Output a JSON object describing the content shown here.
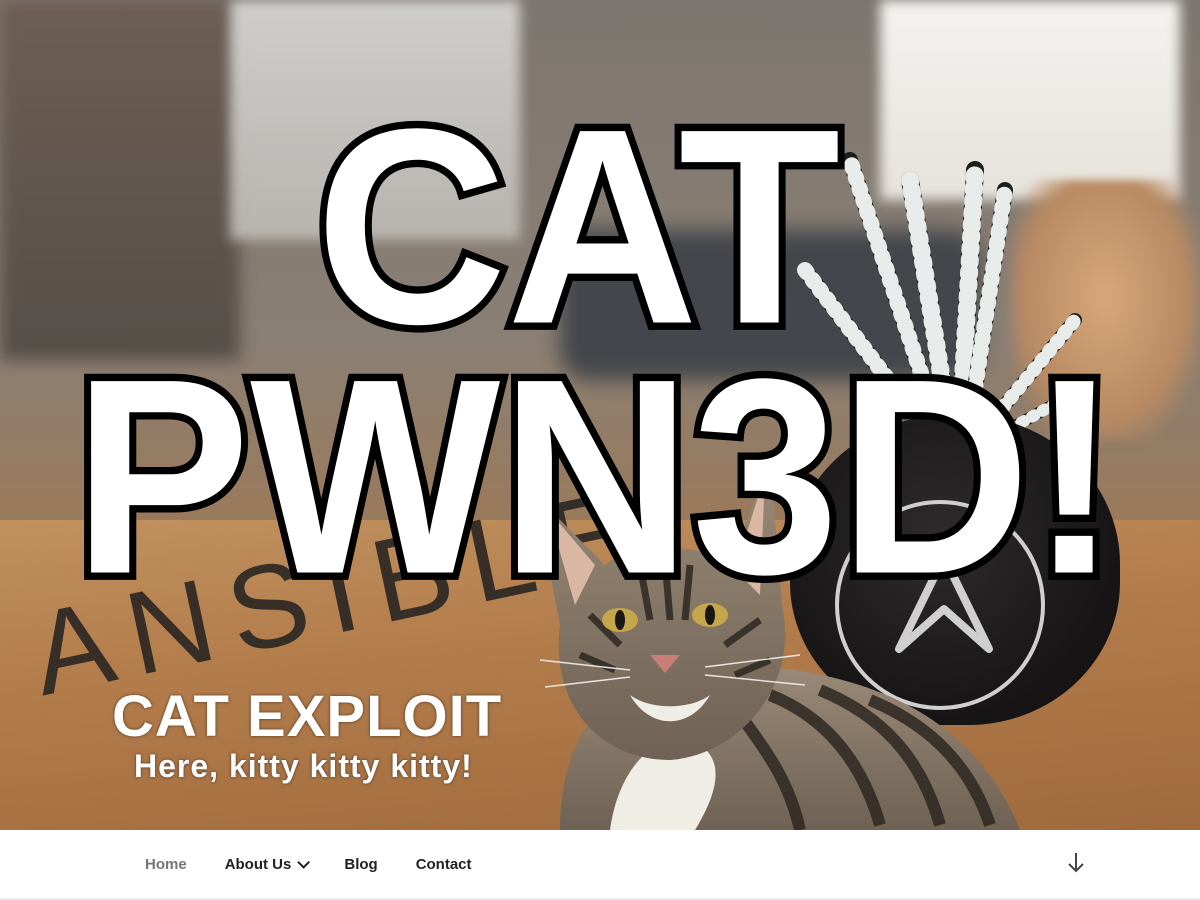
{
  "hero": {
    "meme_line_1": "CAT",
    "meme_line_2": "PWN3D!",
    "background_text": "ANSIBLE"
  },
  "site": {
    "title": "CAT EXPLOIT",
    "tagline": "Here, kitty kitty kitty!"
  },
  "nav": {
    "items": [
      {
        "label": "Home",
        "current": true
      },
      {
        "label": "About Us",
        "has_submenu": true
      },
      {
        "label": "Blog"
      },
      {
        "label": "Contact"
      }
    ],
    "scroll_icon": "arrow-down-icon"
  },
  "colors": {
    "nav_text": "#222222",
    "nav_current": "#767676",
    "meme_fill": "#ffffff",
    "meme_stroke": "#000000"
  }
}
